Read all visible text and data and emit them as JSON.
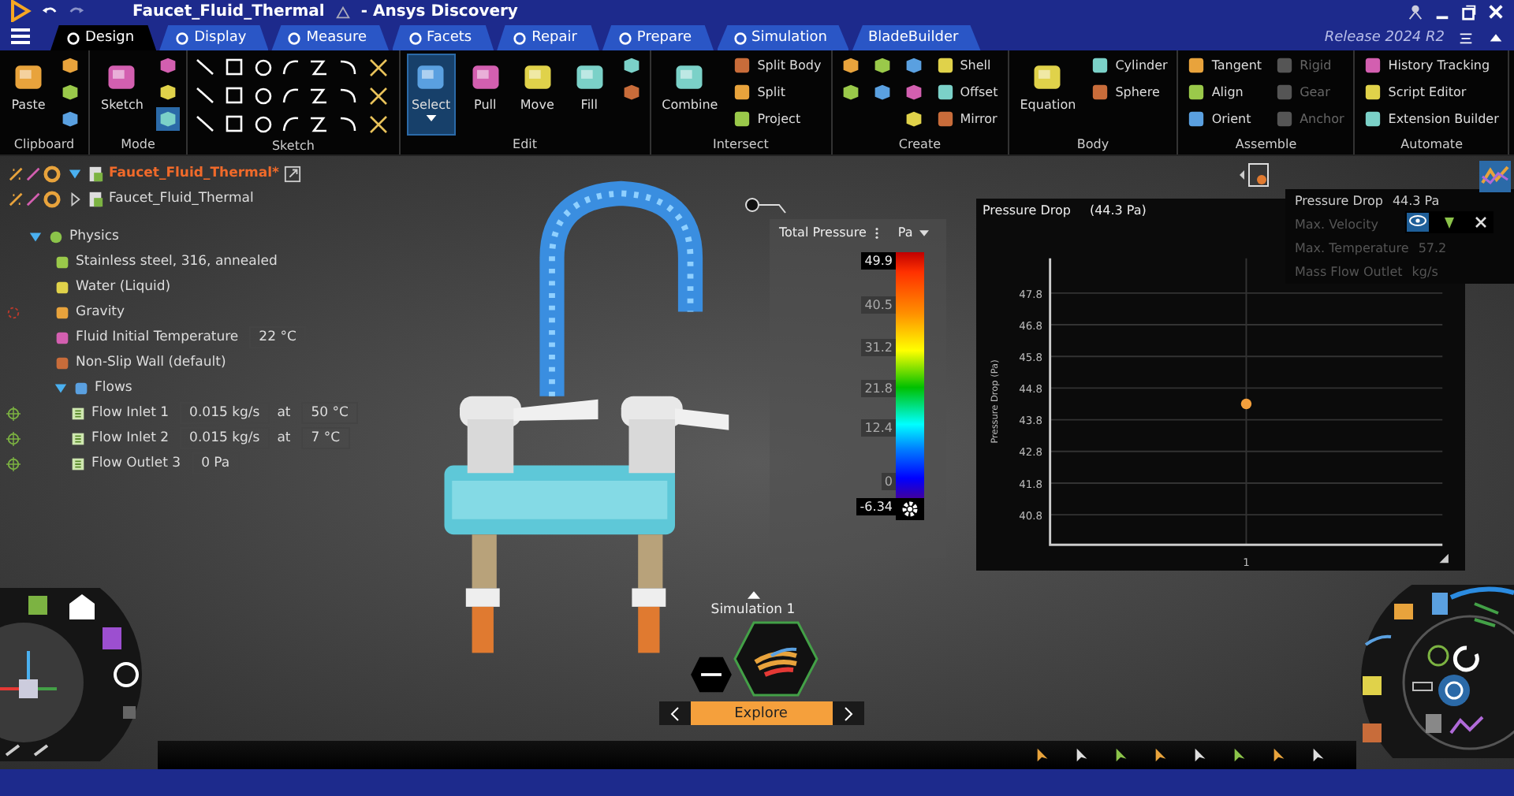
{
  "window": {
    "title": "Faucet_Fluid_Thermal",
    "app": "- Ansys Discovery"
  },
  "tabs": [
    {
      "label": "Design",
      "selected": true
    },
    {
      "label": "Display",
      "selected": false
    },
    {
      "label": "Measure",
      "selected": false
    },
    {
      "label": "Facets",
      "selected": false
    },
    {
      "label": "Repair",
      "selected": false
    },
    {
      "label": "Prepare",
      "selected": false
    },
    {
      "label": "Simulation",
      "selected": false
    },
    {
      "label": "BladeBuilder",
      "selected": false
    }
  ],
  "release": "Release 2024 R2",
  "ribbon": [
    {
      "label": "Clipboard",
      "columns": [
        [
          {
            "label": "Paste",
            "kind": "large",
            "selected": false,
            "disabled": false
          }
        ],
        [
          {
            "kind": "icon",
            "selected": false,
            "disabled": false
          },
          {
            "kind": "icon",
            "selected": false,
            "disabled": false
          },
          {
            "kind": "icon",
            "selected": false,
            "disabled": false
          }
        ]
      ]
    },
    {
      "label": "Mode",
      "columns": [
        [
          {
            "label": "Sketch",
            "kind": "large",
            "selected": false,
            "disabled": false
          }
        ],
        [
          {
            "kind": "icon",
            "selected": false,
            "disabled": false
          },
          {
            "kind": "icon",
            "selected": false,
            "disabled": false
          },
          {
            "kind": "icon",
            "selected": true,
            "disabled": false
          }
        ]
      ]
    },
    {
      "label": "Sketch",
      "columns": [
        [
          {
            "kind": "grid",
            "selected": false,
            "disabled": false
          }
        ]
      ]
    },
    {
      "label": "Edit",
      "columns": [
        [
          {
            "label": "Select",
            "kind": "large",
            "selected": true,
            "disabled": false
          }
        ],
        [
          {
            "label": "Pull",
            "kind": "large",
            "selected": false,
            "disabled": false
          }
        ],
        [
          {
            "label": "Move",
            "kind": "large",
            "selected": false,
            "disabled": false
          }
        ],
        [
          {
            "label": "Fill",
            "kind": "large",
            "selected": false,
            "disabled": false
          }
        ],
        [
          {
            "kind": "icon",
            "selected": false,
            "disabled": false
          },
          {
            "kind": "icon",
            "selected": false,
            "disabled": false
          }
        ]
      ]
    },
    {
      "label": "Intersect",
      "columns": [
        [
          {
            "label": "Combine",
            "kind": "large",
            "selected": false,
            "disabled": false
          }
        ],
        [
          {
            "label": "Split Body",
            "kind": "small",
            "selected": false,
            "disabled": false
          },
          {
            "label": "Split",
            "kind": "small",
            "selected": false,
            "disabled": false
          },
          {
            "label": "Project",
            "kind": "small",
            "selected": false,
            "disabled": false
          }
        ]
      ]
    },
    {
      "label": "Create",
      "columns": [
        [
          {
            "kind": "icon",
            "selected": false,
            "disabled": false
          },
          {
            "kind": "icon",
            "selected": false,
            "disabled": false
          }
        ],
        [
          {
            "kind": "icon",
            "selected": false,
            "disabled": false
          },
          {
            "kind": "icon",
            "selected": false,
            "disabled": false
          }
        ],
        [
          {
            "kind": "icon",
            "selected": false,
            "disabled": false
          },
          {
            "kind": "icon",
            "selected": false,
            "disabled": false
          },
          {
            "kind": "icon",
            "selected": false,
            "disabled": false
          }
        ],
        [
          {
            "label": "Shell",
            "kind": "small",
            "selected": false,
            "disabled": false
          },
          {
            "label": "Offset",
            "kind": "small",
            "selected": false,
            "disabled": false
          },
          {
            "label": "Mirror",
            "kind": "small",
            "selected": false,
            "disabled": false
          }
        ]
      ]
    },
    {
      "label": "Body",
      "columns": [
        [
          {
            "label": "Equation",
            "kind": "large",
            "selected": false,
            "disabled": false
          }
        ],
        [
          {
            "label": "Cylinder",
            "kind": "small",
            "selected": false,
            "disabled": false
          },
          {
            "label": "Sphere",
            "kind": "small",
            "selected": false,
            "disabled": false
          }
        ]
      ]
    },
    {
      "label": "Assemble",
      "columns": [
        [
          {
            "label": "Tangent",
            "kind": "small",
            "selected": false,
            "disabled": false
          },
          {
            "label": "Align",
            "kind": "small",
            "selected": false,
            "disabled": false
          },
          {
            "label": "Orient",
            "kind": "small",
            "selected": false,
            "disabled": false
          }
        ],
        [
          {
            "label": "Rigid",
            "kind": "small",
            "selected": false,
            "disabled": true
          },
          {
            "label": "Gear",
            "kind": "small",
            "selected": false,
            "disabled": true
          },
          {
            "label": "Anchor",
            "kind": "small",
            "selected": false,
            "disabled": true
          }
        ]
      ]
    },
    {
      "label": "Automate",
      "columns": [
        [
          {
            "label": "History Tracking",
            "kind": "small",
            "selected": false,
            "disabled": false
          },
          {
            "label": "Script Editor",
            "kind": "small",
            "selected": false,
            "disabled": false
          },
          {
            "label": "Extension Builder",
            "kind": "small",
            "selected": false,
            "disabled": false
          }
        ]
      ]
    }
  ],
  "documents": [
    {
      "label": "Faucet_Fluid_Thermal*",
      "active": true,
      "expanded": true
    },
    {
      "label": "Faucet_Fluid_Thermal",
      "active": false,
      "expanded": false
    }
  ],
  "physics": {
    "label": "Physics",
    "expanded": true,
    "children": [
      {
        "label": "Stainless steel, 316, annealed"
      },
      {
        "label": "Water (Liquid)"
      },
      {
        "label": "Gravity",
        "kind": "gravity"
      },
      {
        "label": "Fluid Initial Temperature",
        "values": [
          {
            "text": "22 °C",
            "kind": "field"
          }
        ]
      },
      {
        "label": "Non-Slip Wall (default)"
      },
      {
        "label": "Flows",
        "expanded": true,
        "children": [
          {
            "label": "Flow Inlet 1",
            "kind": "location",
            "values": [
              {
                "text": "0.015 kg/s",
                "kind": "field"
              },
              {
                "text": "at",
                "kind": "word"
              },
              {
                "text": "50 °C",
                "kind": "field"
              }
            ]
          },
          {
            "label": "Flow Inlet 2",
            "kind": "location",
            "values": [
              {
                "text": "0.015 kg/s",
                "kind": "field"
              },
              {
                "text": "at",
                "kind": "word"
              },
              {
                "text": "7 °C",
                "kind": "field"
              }
            ]
          },
          {
            "label": "Flow Outlet 3",
            "kind": "location",
            "values": [
              {
                "text": "0 Pa",
                "kind": "field"
              }
            ]
          }
        ]
      }
    ]
  },
  "legend": {
    "title": "Total Pressure",
    "unit": "Pa",
    "labels": [
      "49.9",
      "40.5",
      "31.2",
      "21.8",
      "12.4",
      "0",
      "-6.34"
    ]
  },
  "chart": {
    "title": "Pressure Drop",
    "value": "(44.3 Pa)",
    "chart_data": {
      "type": "scatter",
      "ylabel": "Pressure Drop (Pa)",
      "categories": [
        "1"
      ],
      "series": [
        {
          "color": "#f5a03c",
          "values": [
            44.3
          ]
        }
      ],
      "ylim": [
        39.85,
        48.9
      ],
      "grid": true,
      "yticks": [
        47.8,
        46.8,
        45.8,
        44.8,
        43.8,
        42.8,
        41.8,
        40.8
      ]
    }
  },
  "results": [
    {
      "label": "Pressure Drop",
      "value": "44.3 Pa",
      "selected": true
    },
    {
      "label": "Max. Velocity",
      "selected": false
    },
    {
      "label": "Max. Temperature",
      "value": "57.2",
      "selected": false
    },
    {
      "label": "Mass Flow Outlet",
      "value": "kg/s",
      "selected": false
    }
  ],
  "simulation": {
    "name": "Simulation 1",
    "stage": "Explore"
  }
}
